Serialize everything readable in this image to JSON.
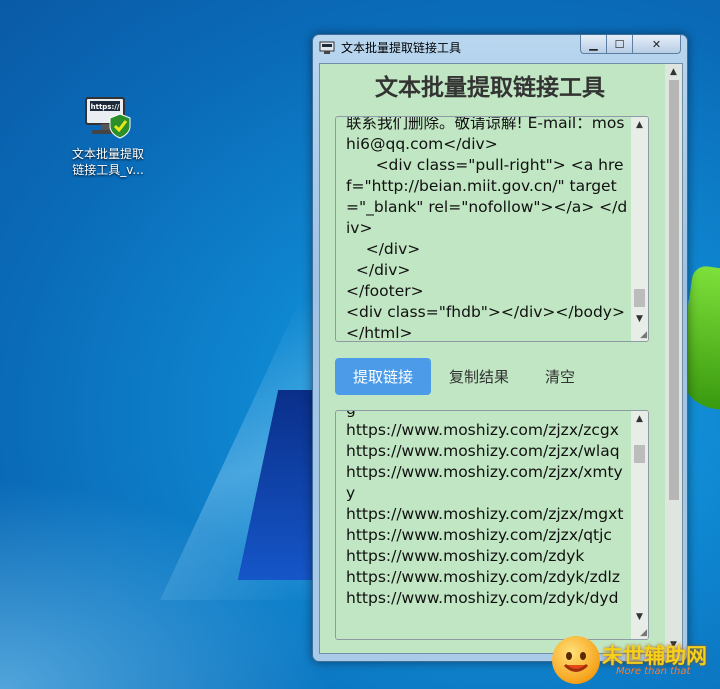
{
  "desktop": {
    "icon_label": "文本批量提取\n链接工具_v..."
  },
  "window": {
    "title": "文本批量提取链接工具",
    "controls": {
      "minimize": "▁",
      "maximize": "☐",
      "close": "✕"
    }
  },
  "app": {
    "heading": "文本批量提取链接工具",
    "input_text": "联系我们删除。敬请谅解! E-mail：moshi6@qq.com</div>\n      <div class=\"pull-right\"> <a href=\"http://beian.miit.gov.cn/\" target=\"_blank\" rel=\"nofollow\"></a> </div>\n    </div>\n  </div>\n</footer>\n<div class=\"fhdb\"></div></body>\n</html>",
    "buttons": {
      "extract": "提取链接",
      "copy": "复制结果",
      "clear": "清空"
    },
    "output_text": "g\nhttps://www.moshizy.com/zjzx/zcgx\nhttps://www.moshizy.com/zjzx/wlaq\nhttps://www.moshizy.com/zjzx/xmtyy\nhttps://www.moshizy.com/zjzx/mgxt\nhttps://www.moshizy.com/zjzx/qtjc\nhttps://www.moshizy.com/zdyk\nhttps://www.moshizy.com/zdyk/zdlz\nhttps://www.moshizy.com/zdyk/dyd"
  },
  "watermark": {
    "text": "未世辅助网",
    "sub": "More than that"
  }
}
